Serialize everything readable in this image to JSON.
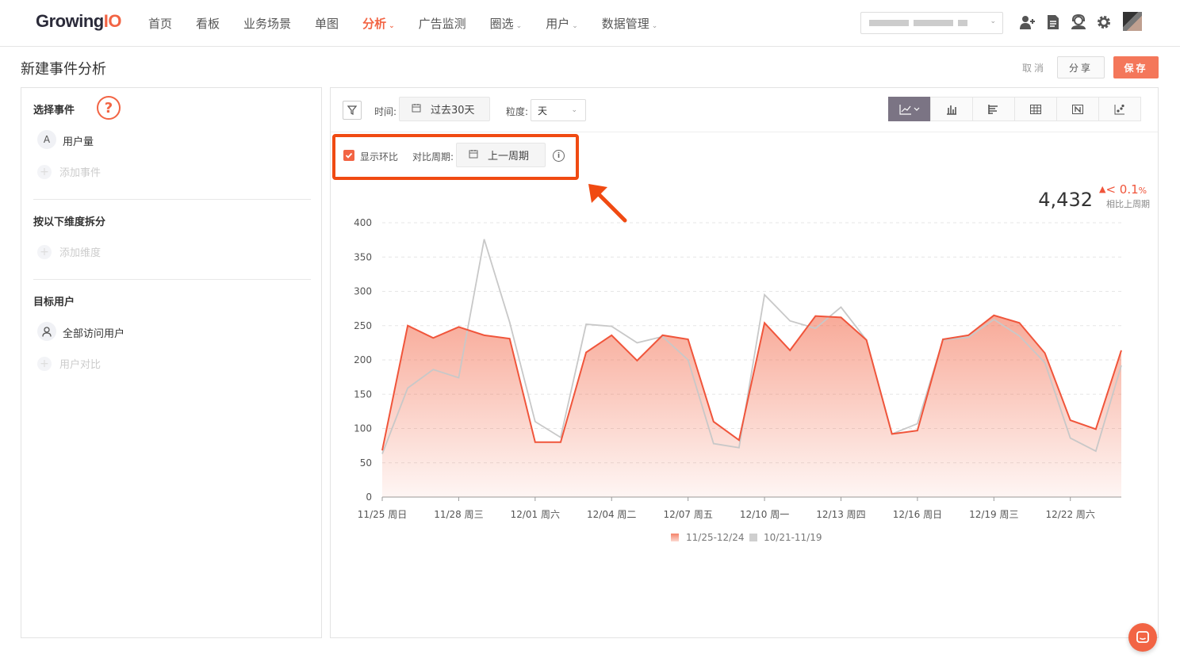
{
  "app": {
    "logo_main": "Growing",
    "logo_accent": "IO"
  },
  "nav": {
    "items": [
      {
        "label": "首页",
        "active": false,
        "dropdown": false
      },
      {
        "label": "看板",
        "active": false,
        "dropdown": false
      },
      {
        "label": "业务场景",
        "active": false,
        "dropdown": false
      },
      {
        "label": "单图",
        "active": false,
        "dropdown": false
      },
      {
        "label": "分析",
        "active": true,
        "dropdown": true
      },
      {
        "label": "广告监测",
        "active": false,
        "dropdown": false
      },
      {
        "label": "圈选",
        "active": false,
        "dropdown": true
      },
      {
        "label": "用户",
        "active": false,
        "dropdown": true
      },
      {
        "label": "数据管理",
        "active": false,
        "dropdown": true
      }
    ],
    "icons": [
      "add-user-icon",
      "document-icon",
      "support-icon",
      "gear-icon"
    ]
  },
  "page": {
    "title": "新建事件分析",
    "cancel_label": "取消",
    "share_label": "分享",
    "save_label": "保存"
  },
  "left": {
    "events_title": "选择事件",
    "event_badge": "A",
    "event_name": "用户量",
    "add_event": "添加事件",
    "dimension_title": "按以下维度拆分",
    "add_dimension": "添加维度",
    "target_title": "目标用户",
    "target_user": "全部访问用户",
    "user_compare": "用户对比"
  },
  "toolbar": {
    "time_label": "时间:",
    "time_value": "过去30天",
    "granularity_label": "粒度:",
    "granularity_value": "天",
    "chart_type_icons": [
      "line-chart-icon",
      "bar-chart-icon",
      "horizontal-bar-icon",
      "table-icon",
      "number-icon",
      "scatter-icon"
    ]
  },
  "compare": {
    "show_label": "显示环比",
    "show_checked": true,
    "period_label": "对比周期:",
    "period_value": "上一周期"
  },
  "summary": {
    "total": "4,432",
    "delta": "< 0.1",
    "delta_unit": "%",
    "delta_caption": "相比上周期"
  },
  "colors": {
    "accent": "#f26444",
    "current_series": "#f0553b",
    "previous_series": "#c8c8c8"
  },
  "chart_data": {
    "type": "area",
    "ylim": [
      0,
      400
    ],
    "yticks": [
      0,
      50,
      100,
      150,
      200,
      250,
      300,
      350,
      400
    ],
    "xtick_labels": [
      "11/25 周日",
      "11/28 周三",
      "12/01 周六",
      "12/04 周二",
      "12/07 周五",
      "12/10 周一",
      "12/13 周四",
      "12/16 周日",
      "12/19 周三",
      "12/22 周六"
    ],
    "xtick_index": [
      0,
      3,
      6,
      9,
      12,
      15,
      18,
      21,
      24,
      27
    ],
    "grid": true,
    "legend_position": "bottom",
    "series": [
      {
        "name": "11/25-12/24",
        "values": [
          68,
          250,
          232,
          248,
          236,
          231,
          80,
          80,
          211,
          236,
          199,
          236,
          230,
          110,
          83,
          254,
          214,
          264,
          262,
          229,
          92,
          97,
          230,
          236,
          265,
          254,
          210,
          112,
          99,
          214
        ]
      },
      {
        "name": "10/21-11/19",
        "values": [
          63,
          159,
          186,
          174,
          376,
          255,
          110,
          87,
          252,
          249,
          225,
          234,
          200,
          78,
          72,
          295,
          257,
          246,
          277,
          229,
          92,
          107,
          229,
          233,
          259,
          235,
          196,
          86,
          67,
          192
        ]
      }
    ]
  }
}
